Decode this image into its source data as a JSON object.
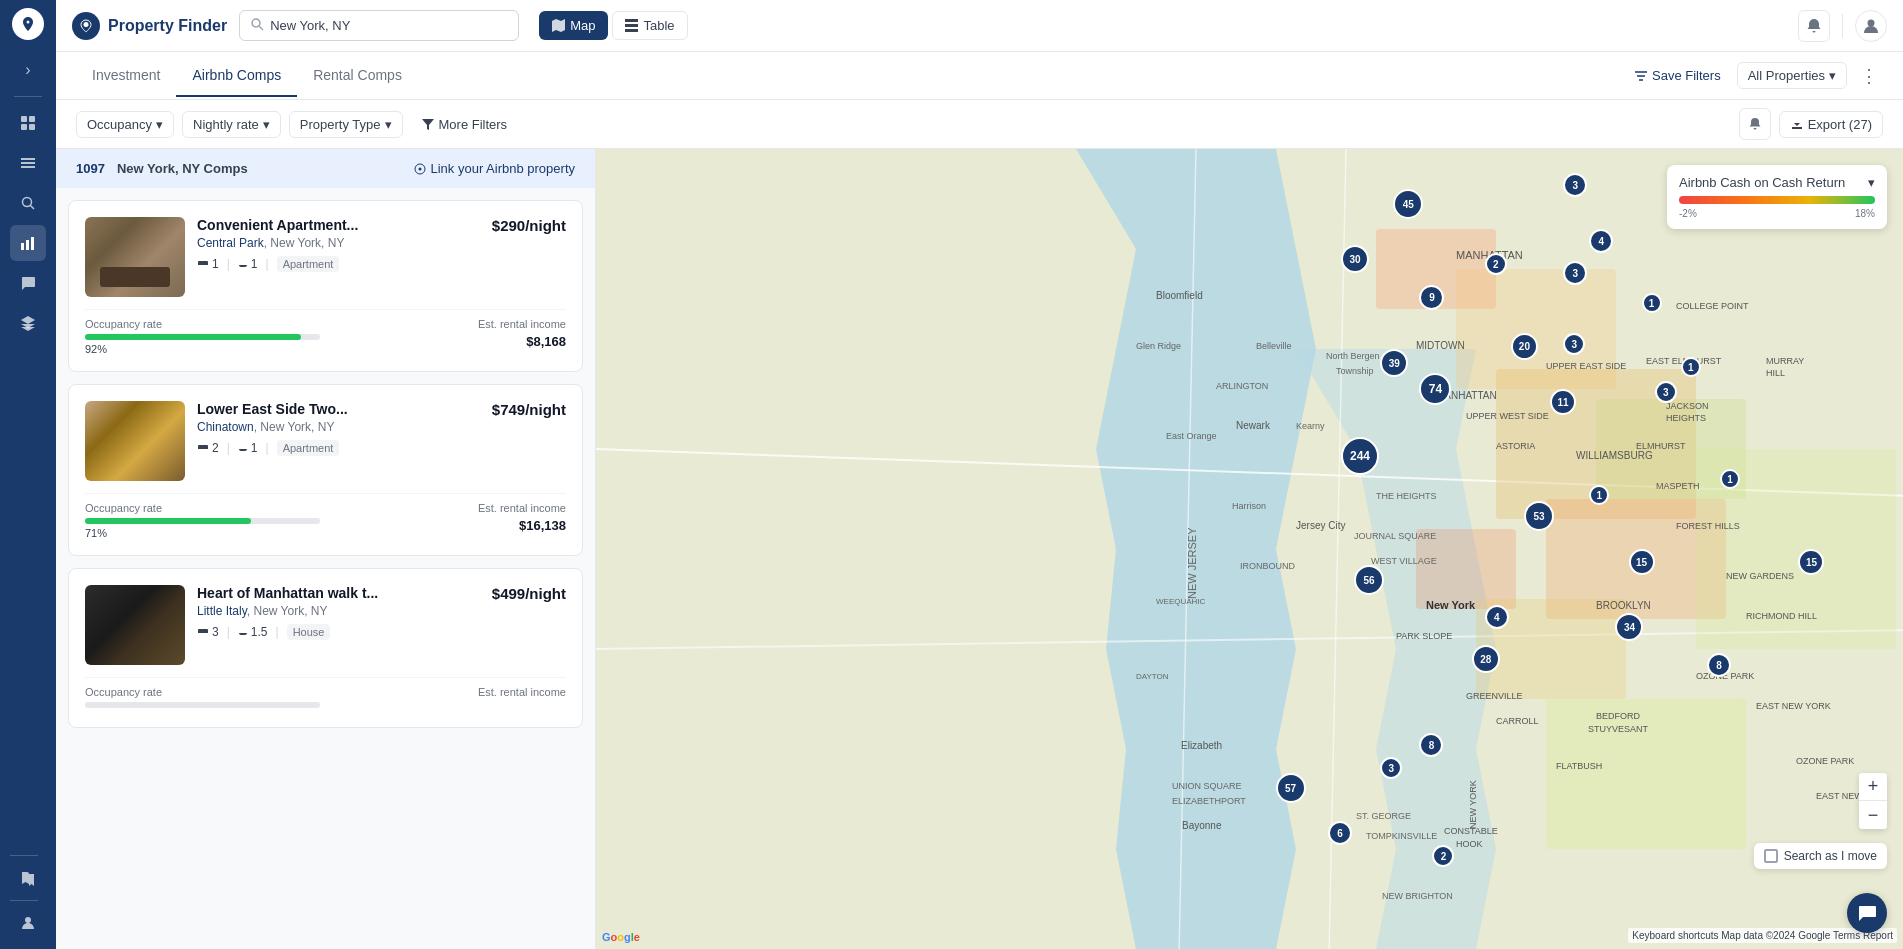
{
  "app": {
    "title": "Property Finder",
    "logo_symbol": "📍"
  },
  "header": {
    "search_value": "New York, NY",
    "search_placeholder": "New York, NY",
    "view_map_label": "Map",
    "view_table_label": "Table",
    "map_icon": "🗺",
    "table_icon": "⊞"
  },
  "tabs": {
    "items": [
      {
        "id": "investment",
        "label": "Investment"
      },
      {
        "id": "airbnb",
        "label": "Airbnb Comps",
        "active": true
      },
      {
        "id": "rental",
        "label": "Rental Comps"
      }
    ],
    "save_filters_label": "Save Filters",
    "all_properties_label": "All Properties",
    "more_icon": "⋮"
  },
  "filters": {
    "occupancy_label": "Occupancy",
    "nightly_rate_label": "Nightly rate",
    "property_type_label": "Property Type",
    "more_filters_label": "More Filters",
    "export_label": "Export (27)",
    "chevron": "▾",
    "filter_icon": "⊿"
  },
  "results": {
    "count": "1097",
    "location": "New York, NY Comps",
    "count_prefix": "",
    "link_label": "Link your Airbnb property",
    "location_icon": "⊙"
  },
  "properties": [
    {
      "id": 1,
      "name": "Convenient Apartment...",
      "price": "$290/night",
      "location_link": "Central Park",
      "location_rest": ", New York, NY",
      "beds": "1",
      "baths": "1",
      "type": "Apartment",
      "occupancy_rate": 92,
      "occupancy_label": "Occupancy rate",
      "est_income_label": "Est. rental income",
      "est_income": "$8,168",
      "image_class": "img-bedroom"
    },
    {
      "id": 2,
      "name": "Lower East Side Two...",
      "price": "$749/night",
      "location_link": "Chinatown",
      "location_rest": ", New York, NY",
      "beds": "2",
      "baths": "1",
      "type": "Apartment",
      "occupancy_rate": 71,
      "occupancy_label": "Occupancy rate",
      "est_income_label": "Est. rental income",
      "est_income": "$16,138",
      "image_class": "img-dining"
    },
    {
      "id": 3,
      "name": "Heart of Manhattan walk t...",
      "price": "$499/night",
      "location_link": "Little Italy",
      "location_rest": ", New York, NY",
      "beds": "3",
      "baths": "1.5",
      "type": "House",
      "occupancy_rate": 0,
      "occupancy_label": "Occupancy rate",
      "est_income_label": "Est. rental income",
      "est_income": "",
      "image_class": "img-living"
    }
  ],
  "map": {
    "legend_title": "Airbnb Cash on Cash Return",
    "legend_min": "-2%",
    "legend_max": "18%",
    "clusters": [
      {
        "id": "c1",
        "label": "45",
        "top": "5%",
        "left": "61%",
        "size": 30
      },
      {
        "id": "c2",
        "label": "3",
        "top": "3%",
        "left": "74%",
        "size": 24
      },
      {
        "id": "c3",
        "label": "30",
        "top": "12%",
        "left": "57%",
        "size": 28
      },
      {
        "id": "c4",
        "label": "4",
        "top": "10%",
        "left": "76%",
        "size": 24
      },
      {
        "id": "c5",
        "label": "2",
        "top": "13%",
        "left": "68%",
        "size": 22
      },
      {
        "id": "c6",
        "label": "9",
        "top": "17%",
        "left": "63%",
        "size": 25
      },
      {
        "id": "c7",
        "label": "3",
        "top": "14%",
        "left": "74%",
        "size": 24
      },
      {
        "id": "c8",
        "label": "3",
        "top": "23%",
        "left": "74%",
        "size": 22
      },
      {
        "id": "c9",
        "label": "1",
        "top": "18%",
        "left": "80%",
        "size": 20
      },
      {
        "id": "c10",
        "label": "39",
        "top": "25%",
        "left": "60%",
        "size": 28
      },
      {
        "id": "c11",
        "label": "20",
        "top": "23%",
        "left": "70%",
        "size": 27
      },
      {
        "id": "c12",
        "label": "74",
        "top": "28%",
        "left": "63%",
        "size": 32
      },
      {
        "id": "c13",
        "label": "11",
        "top": "30%",
        "left": "73%",
        "size": 26
      },
      {
        "id": "c14",
        "label": "3",
        "top": "29%",
        "left": "81%",
        "size": 22
      },
      {
        "id": "c15",
        "label": "1",
        "top": "26%",
        "left": "83%",
        "size": 20
      },
      {
        "id": "c16",
        "label": "244",
        "top": "36%",
        "left": "57%",
        "size": 38
      },
      {
        "id": "c17",
        "label": "53",
        "top": "44%",
        "left": "71%",
        "size": 30
      },
      {
        "id": "c18",
        "label": "56",
        "top": "52%",
        "left": "58%",
        "size": 30
      },
      {
        "id": "c19",
        "label": "1",
        "top": "42%",
        "left": "76%",
        "size": 20
      },
      {
        "id": "c20",
        "label": "15",
        "top": "50%",
        "left": "79%",
        "size": 26
      },
      {
        "id": "c21",
        "label": "15",
        "top": "50%",
        "left": "92%",
        "size": 26
      },
      {
        "id": "c22",
        "label": "4",
        "top": "57%",
        "left": "68%",
        "size": 24
      },
      {
        "id": "c23",
        "label": "34",
        "top": "58%",
        "left": "78%",
        "size": 28
      },
      {
        "id": "c24",
        "label": "28",
        "top": "62%",
        "left": "67%",
        "size": 28
      },
      {
        "id": "c25",
        "label": "8",
        "top": "63%",
        "left": "85%",
        "size": 24
      },
      {
        "id": "c26",
        "label": "8",
        "top": "73%",
        "left": "63%",
        "size": 24
      },
      {
        "id": "c27",
        "label": "3",
        "top": "76%",
        "left": "60%",
        "size": 22
      },
      {
        "id": "c28",
        "label": "57",
        "top": "78%",
        "left": "52%",
        "size": 30
      },
      {
        "id": "c29",
        "label": "6",
        "top": "84%",
        "left": "56%",
        "size": 24
      },
      {
        "id": "c30",
        "label": "2",
        "top": "87%",
        "left": "64%",
        "size": 22
      },
      {
        "id": "c31",
        "label": "1",
        "top": "40%",
        "left": "86%",
        "size": 20
      }
    ],
    "zoom_in": "+",
    "zoom_out": "−",
    "search_as_move_label": "Search as I move",
    "attribution": "Keyboard shortcuts  Map data ©2024 Google  Terms  Report",
    "google_label": "Google"
  },
  "sidebar": {
    "icons": [
      {
        "id": "logo",
        "symbol": "●",
        "active": false
      },
      {
        "id": "arrow",
        "symbol": "›",
        "active": false
      },
      {
        "id": "grid",
        "symbol": "⊞",
        "active": false
      },
      {
        "id": "list",
        "symbol": "≡",
        "active": false
      },
      {
        "id": "search",
        "symbol": "⌕",
        "active": false
      },
      {
        "id": "chart",
        "symbol": "📊",
        "active": false
      },
      {
        "id": "chat",
        "symbol": "💬",
        "active": false
      },
      {
        "id": "layers",
        "symbol": "⊟",
        "active": false
      },
      {
        "id": "book",
        "symbol": "📖",
        "active": false
      },
      {
        "id": "user",
        "symbol": "👤",
        "active": false
      }
    ]
  }
}
